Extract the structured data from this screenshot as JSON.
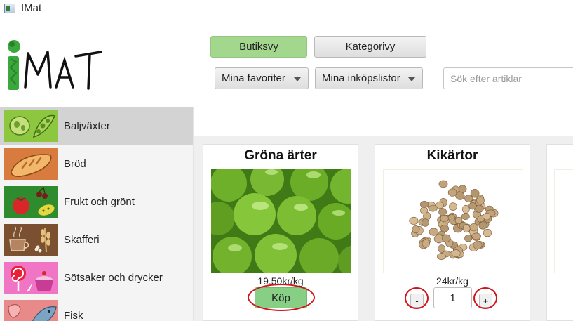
{
  "window": {
    "title": "IMat"
  },
  "logo": {
    "text": "iMat"
  },
  "toolbar": {
    "store_view_label": "Butiksvy",
    "category_view_label": "Kategorivy",
    "favorites_label": "Mina favoriter",
    "shopping_lists_label": "Mina inköpslistor",
    "search_placeholder": "Sök efter artiklar"
  },
  "sidebar": {
    "items": [
      {
        "label": "Baljväxter",
        "icon": "legumes-icon",
        "selected": true
      },
      {
        "label": "Bröd",
        "icon": "bread-icon",
        "selected": false
      },
      {
        "label": "Frukt och grönt",
        "icon": "fruit-vegetables-icon",
        "selected": false
      },
      {
        "label": "Skafferi",
        "icon": "pantry-icon",
        "selected": false
      },
      {
        "label": "Sötsaker och drycker",
        "icon": "sweets-drinks-icon",
        "selected": false
      },
      {
        "label": "Fisk",
        "icon": "fish-icon",
        "selected": false
      }
    ]
  },
  "products": [
    {
      "name": "Gröna ärter",
      "price": "19,50kr/kg",
      "buy_label": "Köp",
      "image": "green-peas-image"
    },
    {
      "name": "Kikärtor",
      "price": "24kr/kg",
      "minus_label": "-",
      "plus_label": "+",
      "quantity": "1",
      "image": "chickpeas-image"
    }
  ],
  "colors": {
    "selected_toolbar": "#a3d78e",
    "buy_button": "#86cf84",
    "highlight_ring": "#d0141b",
    "logo_green": "#3aa83a"
  }
}
